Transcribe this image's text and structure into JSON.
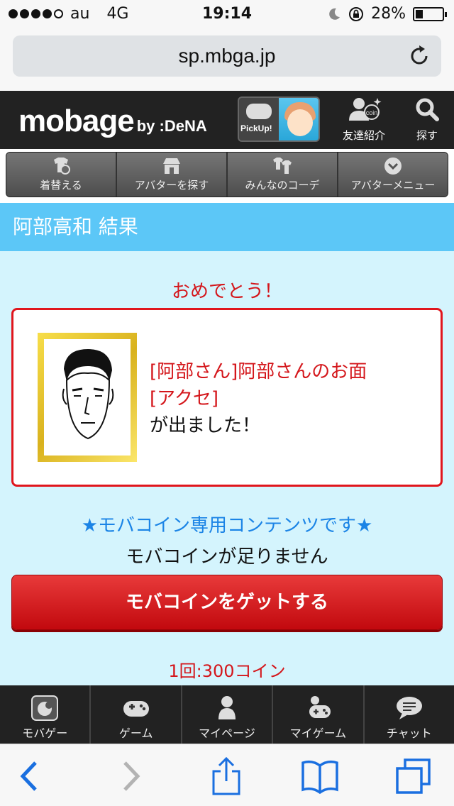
{
  "status": {
    "carrier": "au",
    "network": "4G",
    "time": "19:14",
    "battery": "28%",
    "battery_level": 0.28
  },
  "browser": {
    "url": "sp.mbga.jp"
  },
  "header": {
    "logo_main": "mobage",
    "logo_by": "by :DeNA",
    "pickup_label": "PickUp!",
    "friend_label": "友達紹介",
    "search_label": "探す"
  },
  "avatar_tabs": [
    {
      "label": "着替える"
    },
    {
      "label": "アバターを探す"
    },
    {
      "label": "みんなのコーデ"
    },
    {
      "label": "アバターメニュー"
    }
  ],
  "page_title": "阿部高和 結果",
  "result": {
    "congrats": "おめでとう！",
    "item_line1": "[阿部さん]阿部さんのお面",
    "item_line2": "[アクセ]",
    "item_line3": "が出ました！"
  },
  "coin": {
    "only_notice": "★モバコイン専用コンテンツです★",
    "insufficient": "モバコインが足りません",
    "get_button": "モバコインをゲットする",
    "price": "1回:300コイン"
  },
  "bottom_nav": [
    {
      "label": "モバゲー",
      "icon": "mobage-icon"
    },
    {
      "label": "ゲーム",
      "icon": "gamepad-icon"
    },
    {
      "label": "マイページ",
      "icon": "person-icon"
    },
    {
      "label": "マイゲーム",
      "icon": "my-game-icon"
    },
    {
      "label": "チャット",
      "icon": "chat-icon"
    }
  ]
}
